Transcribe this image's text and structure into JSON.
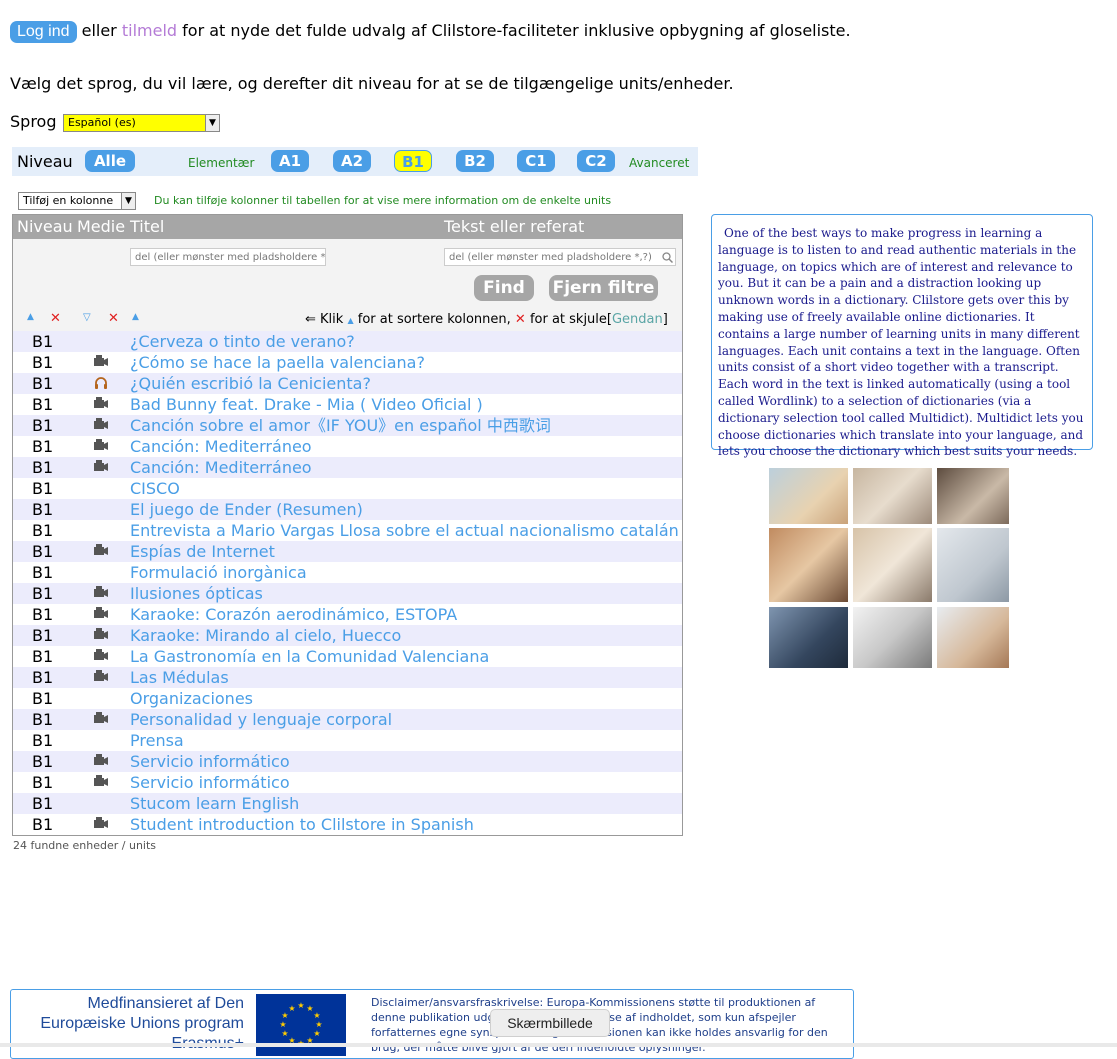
{
  "auth": {
    "login_label": "Log ind",
    "or_text": "eller",
    "register_label": "tilmeld",
    "rest_text": "for at nyde det fulde udvalg af Clilstore-faciliteter inklusive opbygning af gloseliste."
  },
  "intro_text": "Vælg det sprog, du vil lære, og derefter dit niveau for at se de tilgængelige units/enheder.",
  "language": {
    "label": "Sprog",
    "selected": "Español (es)"
  },
  "niveau": {
    "label": "Niveau",
    "all_label": "Alle",
    "elementary_label": "Elementær",
    "advanced_label": "Avanceret",
    "levels": [
      "A1",
      "A2",
      "B1",
      "B2",
      "C1",
      "C2"
    ],
    "selected": "B1"
  },
  "columns": {
    "add_column_label": "Tilføj en kolonne",
    "hint": "Du kan tilføje kolonner til tabellen for at vise mere information om de enkelte units"
  },
  "table": {
    "headers": {
      "niveau": "Niveau",
      "medie": "Medie",
      "titel": "Titel",
      "tekst": "Tekst eller referat"
    },
    "title_filter_placeholder": "del (eller mønster med pladsholdere *,?)",
    "text_filter_placeholder": "del (eller mønster med pladsholdere *,?)",
    "find_label": "Find",
    "clear_label": "Fjern filtre",
    "sort_hint_prefix": "⇐ Klik",
    "sort_hint_mid": "for at sortere kolonnen,",
    "sort_hint_end": "for at skjule",
    "restore_open": "[",
    "restore_label": "Gendan",
    "restore_close": "]",
    "rows": [
      {
        "level": "B1",
        "media": "",
        "title": "¿Cerveza o tinto de verano?"
      },
      {
        "level": "B1",
        "media": "video",
        "title": "¿Cómo se hace la paella valenciana?"
      },
      {
        "level": "B1",
        "media": "audio",
        "title": "¿Quién escribió la Cenicienta?"
      },
      {
        "level": "B1",
        "media": "video",
        "title": "Bad Bunny feat. Drake - Mia ( Video Oficial )"
      },
      {
        "level": "B1",
        "media": "video",
        "title": "Canción sobre el amor《IF YOU》en español 中西歌词"
      },
      {
        "level": "B1",
        "media": "video",
        "title": "Canción: Mediterráneo"
      },
      {
        "level": "B1",
        "media": "video",
        "title": "Canción: Mediterráneo"
      },
      {
        "level": "B1",
        "media": "",
        "title": "CISCO"
      },
      {
        "level": "B1",
        "media": "",
        "title": "El juego de Ender (Resumen)"
      },
      {
        "level": "B1",
        "media": "",
        "title": "Entrevista a Mario Vargas Llosa sobre el actual nacionalismo catalán"
      },
      {
        "level": "B1",
        "media": "video",
        "title": "Espías de Internet"
      },
      {
        "level": "B1",
        "media": "",
        "title": "Formulació inorgànica"
      },
      {
        "level": "B1",
        "media": "video",
        "title": "Ilusiones ópticas"
      },
      {
        "level": "B1",
        "media": "video",
        "title": "Karaoke: Corazón aerodinámico, ESTOPA"
      },
      {
        "level": "B1",
        "media": "video",
        "title": "Karaoke: Mirando al cielo, Huecco"
      },
      {
        "level": "B1",
        "media": "video",
        "title": "La Gastronomía en la Comunidad Valenciana"
      },
      {
        "level": "B1",
        "media": "video",
        "title": "Las Médulas"
      },
      {
        "level": "B1",
        "media": "",
        "title": "Organizaciones"
      },
      {
        "level": "B1",
        "media": "video",
        "title": "Personalidad y lenguaje corporal"
      },
      {
        "level": "B1",
        "media": "",
        "title": "Prensa"
      },
      {
        "level": "B1",
        "media": "video",
        "title": "Servicio informático"
      },
      {
        "level": "B1",
        "media": "video",
        "title": "Servicio informático"
      },
      {
        "level": "B1",
        "media": "",
        "title": "Stucom learn English"
      },
      {
        "level": "B1",
        "media": "video",
        "title": "Student introduction to Clilstore in Spanish"
      }
    ],
    "count_text": "24 fundne enheder / units"
  },
  "info_text": "One of the best ways to make progress in learning a language is to listen to and read authentic materials in the language, on topics which are of interest and relevance to you. But it can be a pain and a distraction looking up unknown words in a dictionary. Clilstore gets over this by making use of freely available online dictionaries. It contains a large number of learning units in many different languages. Each unit contains a text in the language. Often units consist of a short video together with a transcript. Each word in the text is linked automatically (using a tool called Wordlink) to a selection of dictionaries (via a dictionary selection tool called Multidict). Multidict lets you choose dictionaries which translate into your language, and lets you choose the dictionary which best suits your needs.",
  "footer": {
    "cofunded_line1": "Medfinansieret af Den",
    "cofunded_line2": "Europæiske Unions program",
    "cofunded_line3": "Erasmus+",
    "disclaimer": "Disclaimer/ansvarsfraskrivelse: Europa-Kommissionens støtte til produktionen af denne publikation udgør ikke en godkendelse af indholdet, som kun afspejler forfatternes egne synspunkter, og Kommissionen kan ikke holdes ansvarlig for den brug, der måtte blive gjort af de deri indeholdte oplysninger."
  },
  "tooltip_text": "Skærmbillede",
  "colors": {
    "accent": "#4a9ee6",
    "selected_level": "#ffff00",
    "green": "#228b22",
    "info_text": "#1a1a8c",
    "register": "#b47bd6"
  }
}
